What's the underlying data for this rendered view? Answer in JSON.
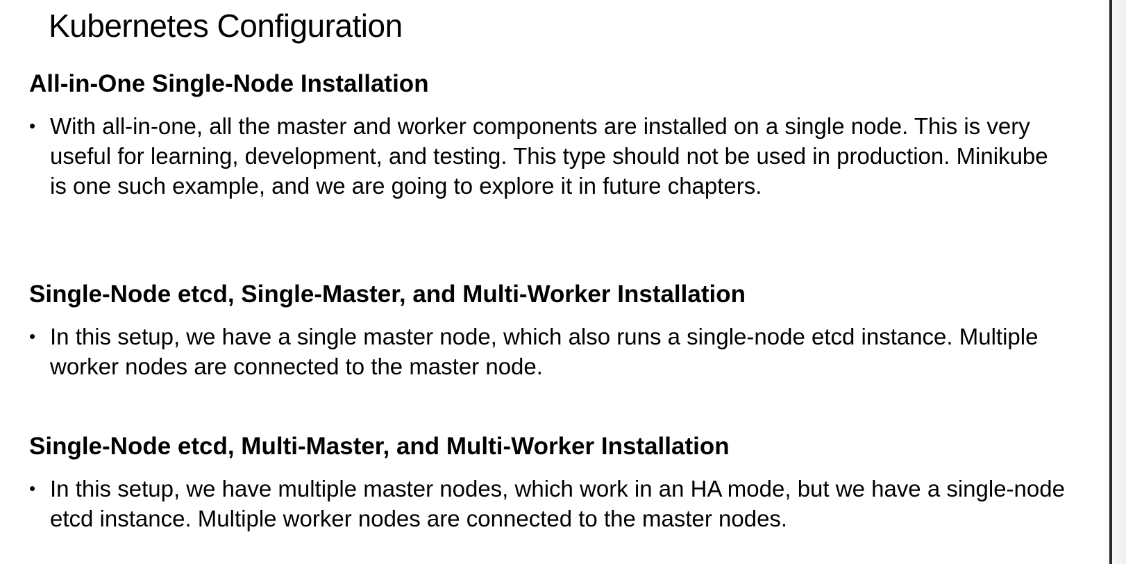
{
  "slide": {
    "title": "Kubernetes Configuration",
    "sections": [
      {
        "heading": "All-in-One Single-Node Installation",
        "bullet_symbol": "•",
        "bullet_text": "With all-in-one, all the master and worker components are installed on a single node. This is very useful for learning, development, and testing. This type should not be used in production. Minikube is one such example, and we are going to explore it in future chapters."
      },
      {
        "heading": "Single-Node etcd, Single-Master, and Multi-Worker Installation",
        "bullet_symbol": "•",
        "bullet_text": "In this setup, we have a single master node, which also runs a single-node etcd instance. Multiple worker nodes are connected to the master node."
      },
      {
        "heading": "Single-Node etcd, Multi-Master, and Multi-Worker Installation",
        "bullet_symbol": "•",
        "bullet_text": "In this setup, we have multiple master nodes, which work in an HA mode, but we have a single-node etcd instance. Multiple worker nodes are connected to the master nodes."
      }
    ]
  }
}
